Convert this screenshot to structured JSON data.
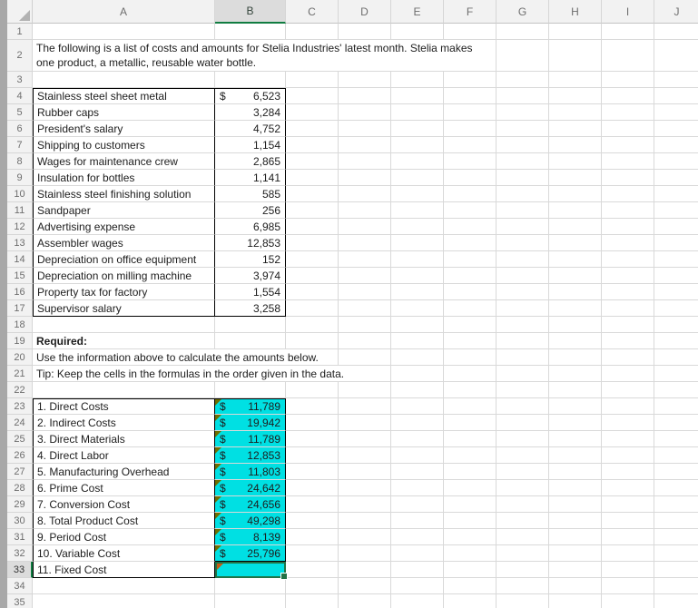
{
  "sheet": {
    "column_headers": [
      "A",
      "B",
      "C",
      "D",
      "E",
      "F",
      "G",
      "H",
      "I",
      "J"
    ],
    "selected_column": "B",
    "selected_row_header": "33",
    "selected_cell": "B33",
    "colors": {
      "answer_fill": "#00e0e3",
      "selection_border": "#217346",
      "flag_olive": "#6e6e00",
      "flag_orange": "#c55a11",
      "header_accent": "#107C41"
    },
    "rows": [
      {
        "n": "1"
      },
      {
        "n": "2",
        "merge": 6,
        "lines": [
          "The following is a list of costs and amounts for Stelia Industries' latest month. Stelia makes",
          "one product, a metallic, reusable water bottle."
        ]
      },
      {
        "n": "3"
      },
      {
        "n": "4",
        "table": "cost",
        "edge": "top",
        "label": "Stainless steel sheet metal",
        "dollar": "$",
        "value": "6,523"
      },
      {
        "n": "5",
        "table": "cost",
        "label": "Rubber caps",
        "value": "3,284"
      },
      {
        "n": "6",
        "table": "cost",
        "label": "President's salary",
        "value": "4,752"
      },
      {
        "n": "7",
        "table": "cost",
        "label": "Shipping to customers",
        "value": "1,154"
      },
      {
        "n": "8",
        "table": "cost",
        "label": "Wages for maintenance crew",
        "value": "2,865"
      },
      {
        "n": "9",
        "table": "cost",
        "label": "Insulation for bottles",
        "value": "1,141"
      },
      {
        "n": "10",
        "table": "cost",
        "label": "Stainless steel finishing solution",
        "value": "585"
      },
      {
        "n": "11",
        "table": "cost",
        "label": "Sandpaper",
        "value": "256"
      },
      {
        "n": "12",
        "table": "cost",
        "label": "Advertising expense",
        "value": "6,985"
      },
      {
        "n": "13",
        "table": "cost",
        "label": "Assembler wages",
        "value": "12,853"
      },
      {
        "n": "14",
        "table": "cost",
        "label": "Depreciation on office equipment",
        "value": "152"
      },
      {
        "n": "15",
        "table": "cost",
        "label": "Depreciation on milling machine",
        "value": "3,974"
      },
      {
        "n": "16",
        "table": "cost",
        "label": "Property tax for factory",
        "value": "1,554"
      },
      {
        "n": "17",
        "table": "cost",
        "edge": "bottom",
        "label": "Supervisor salary",
        "value": "3,258"
      },
      {
        "n": "18"
      },
      {
        "n": "19",
        "merge": 1,
        "bold": true,
        "text": "Required:"
      },
      {
        "n": "20",
        "merge": 3,
        "text": "Use the information above to calculate the amounts below."
      },
      {
        "n": "21",
        "merge": 4,
        "text": "Tip: Keep the cells in the formulas in the order given in the data."
      },
      {
        "n": "22"
      },
      {
        "n": "23",
        "table": "answer",
        "edge": "top",
        "label": "1. Direct Costs",
        "dollar": "$",
        "value": "11,789",
        "flag": "olive"
      },
      {
        "n": "24",
        "table": "answer",
        "label": "2. Indirect Costs",
        "dollar": "$",
        "value": "19,942",
        "flag": "olive"
      },
      {
        "n": "25",
        "table": "answer",
        "label": "3. Direct Materials",
        "dollar": "$",
        "value": "11,789",
        "flag": "olive"
      },
      {
        "n": "26",
        "table": "answer",
        "label": "4. Direct Labor",
        "dollar": "$",
        "value": "12,853",
        "flag": "olive"
      },
      {
        "n": "27",
        "table": "answer",
        "label": "5. Manufacturing Overhead",
        "dollar": "$",
        "value": "11,803",
        "flag": "olive"
      },
      {
        "n": "28",
        "table": "answer",
        "label": "6. Prime Cost",
        "dollar": "$",
        "value": "24,642",
        "flag": "olive"
      },
      {
        "n": "29",
        "table": "answer",
        "label": "7. Conversion Cost",
        "dollar": "$",
        "value": "24,656",
        "flag": "olive"
      },
      {
        "n": "30",
        "table": "answer",
        "label": "8. Total Product Cost",
        "dollar": "$",
        "value": "49,298",
        "flag": "olive"
      },
      {
        "n": "31",
        "table": "answer",
        "label": "9. Period Cost",
        "dollar": "$",
        "value": "8,139",
        "flag": "olive"
      },
      {
        "n": "32",
        "table": "answer",
        "edge": "value-bottom",
        "label": "10. Variable Cost",
        "dollar": "$",
        "value": "25,796",
        "flag": "olive"
      },
      {
        "n": "33",
        "table": "answer",
        "edge": "bottom",
        "label": "11. Fixed Cost",
        "flag": "orange",
        "selected": true
      },
      {
        "n": "34"
      },
      {
        "n": "35"
      }
    ]
  }
}
